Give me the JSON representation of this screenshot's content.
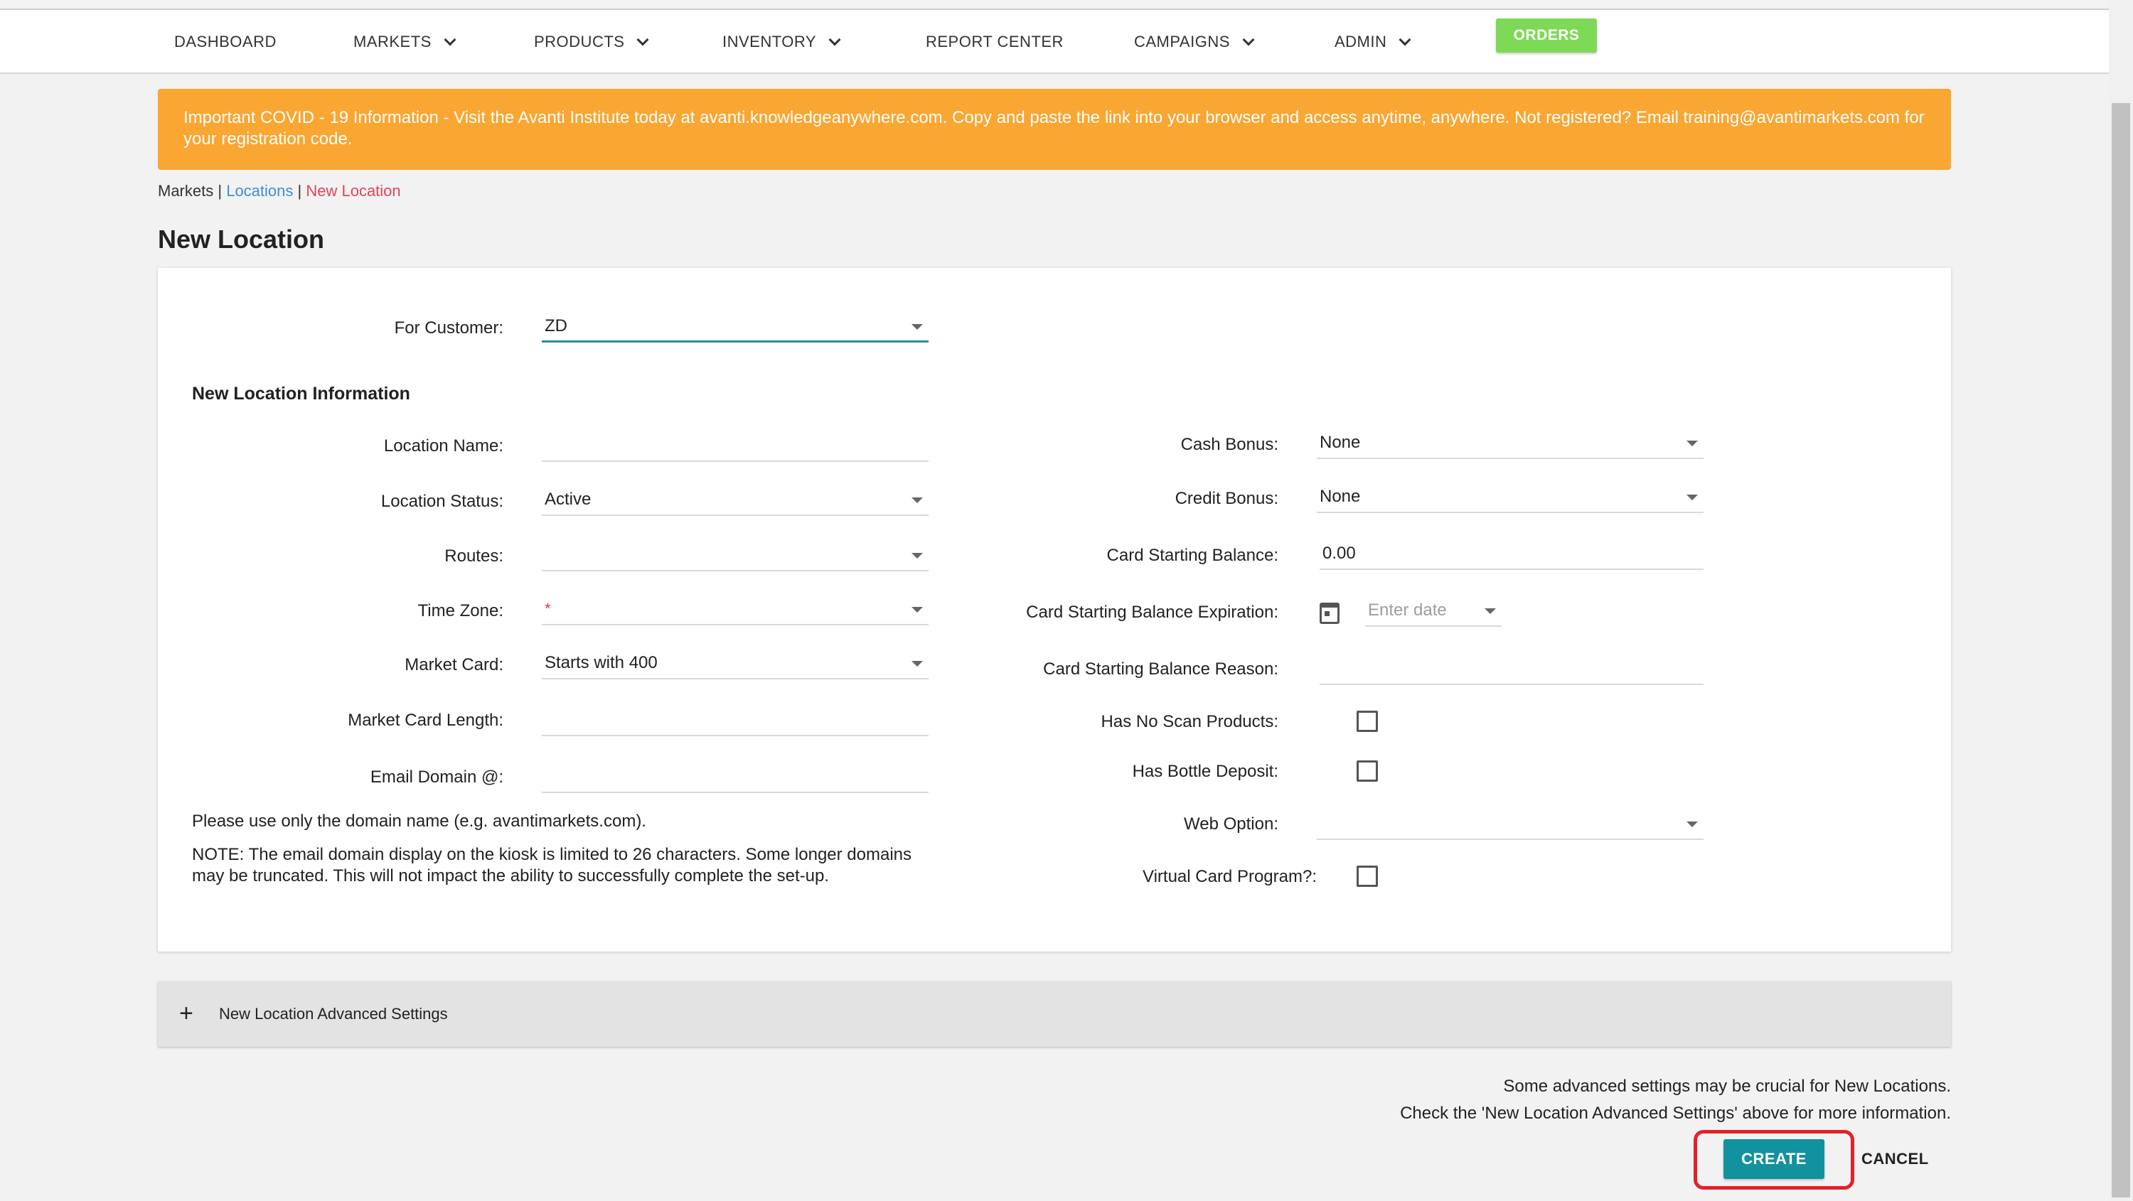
{
  "nav": {
    "items": [
      {
        "label": "DASHBOARD",
        "has_menu": false
      },
      {
        "label": "MARKETS",
        "has_menu": true
      },
      {
        "label": "PRODUCTS",
        "has_menu": true
      },
      {
        "label": "INVENTORY",
        "has_menu": true
      },
      {
        "label": "REPORT CENTER",
        "has_menu": false
      },
      {
        "label": "CAMPAIGNS",
        "has_menu": true
      },
      {
        "label": "ADMIN",
        "has_menu": true
      }
    ],
    "orders_label": "ORDERS"
  },
  "banner": {
    "text": "Important COVID - 19 Information - Visit the Avanti Institute today at avanti.knowledgeanywhere.com. Copy and paste the link into your browser and access anytime, anywhere. Not registered? Email training@avantimarkets.com for your registration code."
  },
  "breadcrumb": {
    "root": "Markets",
    "sep1": " | ",
    "locations": "Locations",
    "sep2": " | ",
    "current": "New Location"
  },
  "page_title": "New Location",
  "form": {
    "customer_label": "For Customer:",
    "customer_value": "ZD",
    "section_title": "New Location Information",
    "location_name_label": "Location Name:",
    "location_name_value": "",
    "location_status_label": "Location Status:",
    "location_status_value": "Active",
    "routes_label": "Routes:",
    "routes_value": "",
    "time_zone_label": "Time Zone:",
    "time_zone_required": "*",
    "market_card_label": "Market Card:",
    "market_card_value": "Starts with 400",
    "market_card_length_label": "Market Card Length:",
    "market_card_length_value": "",
    "email_domain_label": "Email Domain @:",
    "email_domain_value": "",
    "domain_note": "Please use only the domain name (e.g. avantimarkets.com).",
    "kiosk_note_line1": "NOTE: The email domain display on the kiosk is limited to 26 characters. Some longer domains",
    "kiosk_note_line2": "may be truncated. This will not impact the ability to successfully complete the set-up.",
    "cash_bonus_label": "Cash Bonus:",
    "cash_bonus_value": "None",
    "credit_bonus_label": "Credit Bonus:",
    "credit_bonus_value": "None",
    "card_balance_label": "Card Starting Balance:",
    "card_balance_value": "0.00",
    "card_expiration_label": "Card Starting Balance Expiration:",
    "card_expiration_placeholder": "Enter date",
    "card_reason_label": "Card Starting Balance Reason:",
    "card_reason_value": "",
    "no_scan_label": "Has No Scan Products:",
    "no_scan_checked": false,
    "bottle_deposit_label": "Has Bottle Deposit:",
    "bottle_deposit_checked": false,
    "web_option_label": "Web Option:",
    "web_option_value": "",
    "virtual_card_label": "Virtual Card Program?:",
    "virtual_card_checked": false
  },
  "advanced": {
    "toggle_icon": "+",
    "label": "New Location Advanced Settings"
  },
  "footer": {
    "hint_line1": "Some advanced settings may be crucial for New Locations.",
    "hint_line2": "Check the 'New Location Advanced Settings' above for more information.",
    "create_label": "CREATE",
    "cancel_label": "CANCEL"
  },
  "colors": {
    "banner": "#f9a632",
    "orders": "#7ed957",
    "create": "#12919e",
    "highlight": "#e5202b",
    "link": "#3f8fd6",
    "current_crumb": "#e0455a"
  }
}
